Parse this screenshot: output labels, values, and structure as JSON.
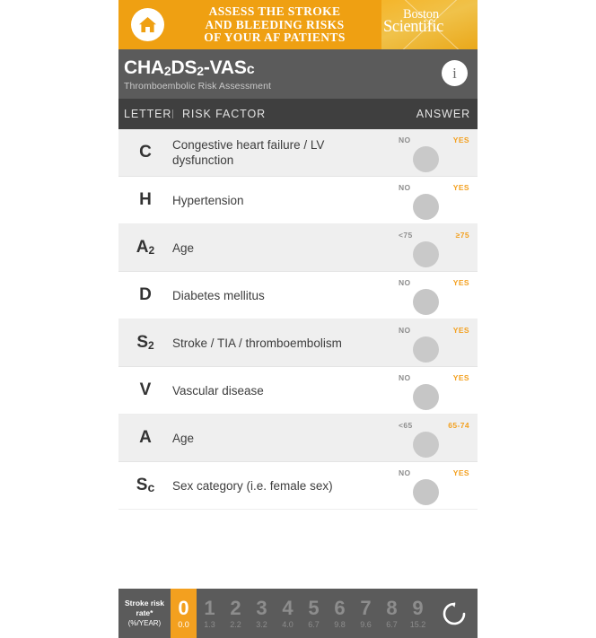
{
  "banner": {
    "home_icon": "home-icon",
    "headline_lines": [
      "ASSESS THE STROKE",
      "AND BLEEDING RISKS",
      "OF YOUR AF PATIENTS"
    ],
    "brand_line1": "Boston",
    "brand_line2": "Scientific",
    "bg_color": "#efa012"
  },
  "titlebar": {
    "title_main": "CHA",
    "title_sub1": "2",
    "title_mid": "DS",
    "title_sub2": "2",
    "title_tail": "-VAS",
    "title_sc": "c",
    "subtitle": "Thromboembolic Risk Assessment",
    "info_icon_label": "i",
    "bg_color": "#5b5b5b"
  },
  "column_header": {
    "letter": "LETTER",
    "risk_factor": "RISK FACTOR",
    "answer": "ANSWER",
    "bg_color": "#3f3f3f"
  },
  "rows": [
    {
      "letter": "C",
      "sub": "",
      "factor": "Congestive heart failure / LV dysfunction",
      "off": "NO",
      "on": "YES",
      "selected": "none"
    },
    {
      "letter": "H",
      "sub": "",
      "factor": "Hypertension",
      "off": "NO",
      "on": "YES",
      "selected": "none"
    },
    {
      "letter": "A",
      "sub": "2",
      "factor": "Age",
      "off": "<75",
      "on": "≥75",
      "selected": "none"
    },
    {
      "letter": "D",
      "sub": "",
      "factor": "Diabetes mellitus",
      "off": "NO",
      "on": "YES",
      "selected": "none"
    },
    {
      "letter": "S",
      "sub": "2",
      "factor": "Stroke / TIA / thromboembolism",
      "off": "NO",
      "on": "YES",
      "selected": "none"
    },
    {
      "letter": "V",
      "sub": "",
      "factor": "Vascular disease",
      "off": "NO",
      "on": "YES",
      "selected": "none"
    },
    {
      "letter": "A",
      "sub": "",
      "factor": "Age",
      "off": "<65",
      "on": "65-74",
      "selected": "none"
    },
    {
      "letter": "S",
      "sub": "c",
      "factor": "Sex category (i.e. female sex)",
      "off": "NO",
      "on": "YES",
      "selected": "none"
    }
  ],
  "footer": {
    "label_line1": "Stroke risk",
    "label_line2": "rate*",
    "label_unit": "(%/YEAR)",
    "active_score": 0,
    "accent_color": "#f3a01f",
    "reset_icon": "reset-icon",
    "scores": [
      {
        "score": "0",
        "rate": "0.0"
      },
      {
        "score": "1",
        "rate": "1.3"
      },
      {
        "score": "2",
        "rate": "2.2"
      },
      {
        "score": "3",
        "rate": "3.2"
      },
      {
        "score": "4",
        "rate": "4.0"
      },
      {
        "score": "5",
        "rate": "6.7"
      },
      {
        "score": "6",
        "rate": "9.8"
      },
      {
        "score": "7",
        "rate": "9.6"
      },
      {
        "score": "8",
        "rate": "6.7"
      },
      {
        "score": "9",
        "rate": "15.2"
      }
    ]
  }
}
